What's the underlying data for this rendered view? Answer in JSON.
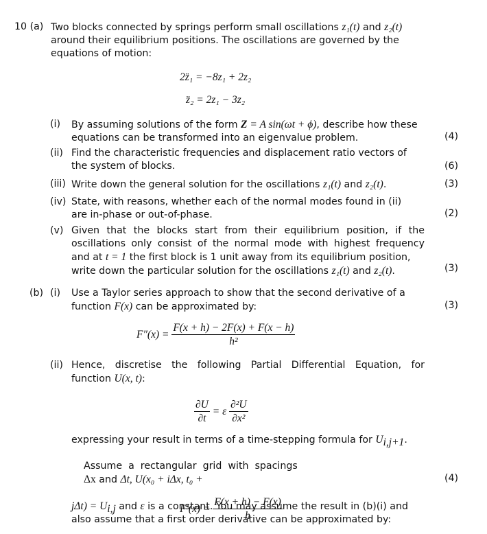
{
  "question": {
    "number": "10",
    "part_a": {
      "label": "(a)",
      "intro_line1": "Two blocks connected by springs perform small oscillations",
      "intro_and": "and",
      "intro_line2": "around their equilibrium positions.  The oscillations are governed by the",
      "intro_line3": "equations of motion:",
      "eq1": "2z̈₁ = −8z₁ + 2z₂",
      "eq2": "z̈₂ = 2z₁ − 3z₂",
      "z1t": "z₁(t)",
      "z2t": "z₂(t)",
      "subparts": [
        {
          "label": "(i)",
          "line1_pre": "By assuming solutions of the form",
          "line1_math_Z": "Z",
          "line1_math_rest": " = A sin(ωt + ϕ)",
          "line1_post": ", describe how these",
          "line2": "equations can be transformed into an eigenvalue problem.",
          "marks": "(4)"
        },
        {
          "label": "(ii)",
          "line1": "Find the characteristic frequencies and displacement ratio vectors of",
          "line2": "the system of blocks.",
          "marks": "(6)"
        },
        {
          "label": "(iii)",
          "line1_pre": "Write down the general solution for the oscillations",
          "line1_and": "and",
          "line1_end": ".",
          "marks": "(3)"
        },
        {
          "label": "(iv)",
          "line1": "State, with reasons, whether each of the normal modes found in (ii)",
          "line2": "are in-phase or out-of-phase.",
          "marks": "(2)"
        },
        {
          "label": "(v)",
          "line1": "Given that the blocks start from their equilibrium position, if the",
          "line2": "oscillations only consist of the normal mode with highest frequency",
          "line3_pre": "and at",
          "line3_math": "t = 1",
          "line3_post": " the first block is 1 unit away from its equilibrium position,",
          "line4_pre": "write down the particular solution for the oscillations",
          "line4_and": "and",
          "line4_end": ".",
          "marks": "(3)"
        }
      ]
    },
    "part_b": {
      "label": "(b)",
      "subparts": [
        {
          "label": "(i)",
          "line1": "Use a Taylor series approach to show that the second derivative of a",
          "line2_pre": "function",
          "line2_math": "F(x)",
          "line2_post": " can be approximated by:",
          "marks": "(3)",
          "formula_lhs": "F″(x) =",
          "formula_num": "F(x + h) − 2F(x) + F(x − h)",
          "formula_den": "h²"
        },
        {
          "label": "(ii)",
          "line1": "Hence,  discretise  the  following  Partial  Differential  Equation,  for",
          "line2_pre": "function",
          "line2_math": "U(x, t)",
          "line2_post": ":",
          "pde_lhs_num": "∂U",
          "pde_lhs_den": "∂t",
          "pde_mid": "= ε",
          "pde_rhs_num": "∂²U",
          "pde_rhs_den": "∂x²",
          "p1": "expressing your result in terms of a time-stepping formula for",
          "p1_math": "U",
          "p1_sub": "i,j+1",
          "p1_end": ".",
          "p2_pre": "Assume  a  rectangular  grid  with  spacings",
          "p2_dx": "Δx",
          "p2_and": " and ",
          "p2_dt": "Δt,",
          "p2_math": " U(x₀ + iΔx, t₀ +",
          "p3_math1": "jΔt) = U",
          "p3_sub": "i,j",
          "p3_post": " and ",
          "p3_eps": "ε",
          "p3_end": " is a constant.  You may assume the result in (b)(i) and",
          "p4": "also assume that a first order derivative can be approximated by:",
          "marks": "(4)",
          "formula_lhs": "F′(x) =",
          "formula_num": "F(x + h) − F(x)",
          "formula_den": "h"
        }
      ]
    }
  }
}
